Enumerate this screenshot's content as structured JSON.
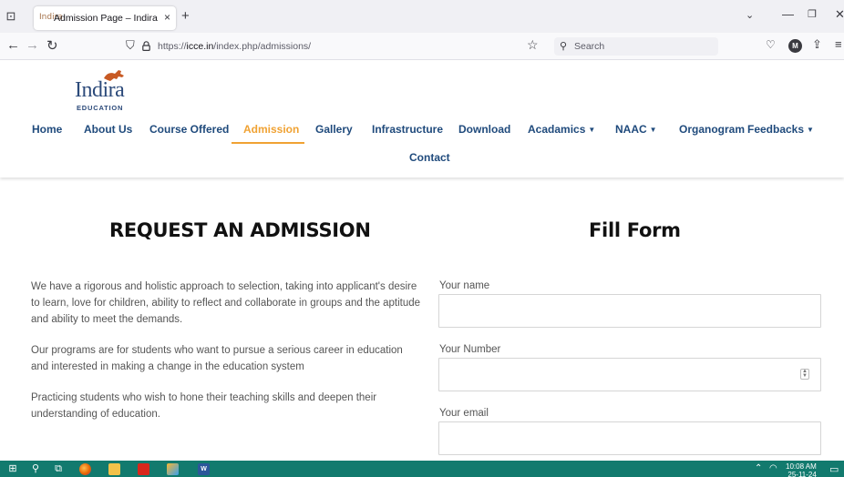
{
  "browser": {
    "tab": {
      "title": "Admission Page – Indira Educat",
      "close": "×",
      "favicon": "Indira"
    },
    "new_tab": "+",
    "url_prefix": "https://",
    "url_domain": "icce.in",
    "url_path": "/index.php/admissions/",
    "search_placeholder": "Search",
    "account_initial": "M"
  },
  "site": {
    "logo": {
      "name": "Indira",
      "sub": "EDUCATION"
    },
    "menu": {
      "home": "Home",
      "about": "About Us",
      "courses": "Course Offered",
      "admission": "Admission",
      "gallery": "Gallery",
      "infrastructure": "Infrastructure",
      "download": "Download",
      "academics": "Acadamics",
      "naac": "NAAC",
      "organogram": "Organogram",
      "feedbacks": "Feedbacks",
      "contact": "Contact"
    },
    "active_item": "Admission",
    "accent_color": "#f0a233",
    "nav_color": "#1f4a7c"
  },
  "content": {
    "left_heading": "REQUEST AN ADMISSION",
    "right_heading": "Fill Form",
    "paragraphs": [
      "We have a rigorous and holistic approach to selection, taking into applicant's desire to learn, love for children, ability to reflect and collaborate in groups and the aptitude and ability to meet the demands.",
      "Our programs are for students who want to pursue a serious career in education and interested in making a change in the education system",
      "Practicing students who wish to hone their teaching skills and deepen their understanding of education."
    ],
    "form": {
      "name_label": "Your name",
      "number_label": "Your Number",
      "email_label": "Your email"
    }
  },
  "taskbar": {
    "time": "10:08 AM",
    "date": "25-11-24",
    "taskbar_color": "#127a6e"
  }
}
